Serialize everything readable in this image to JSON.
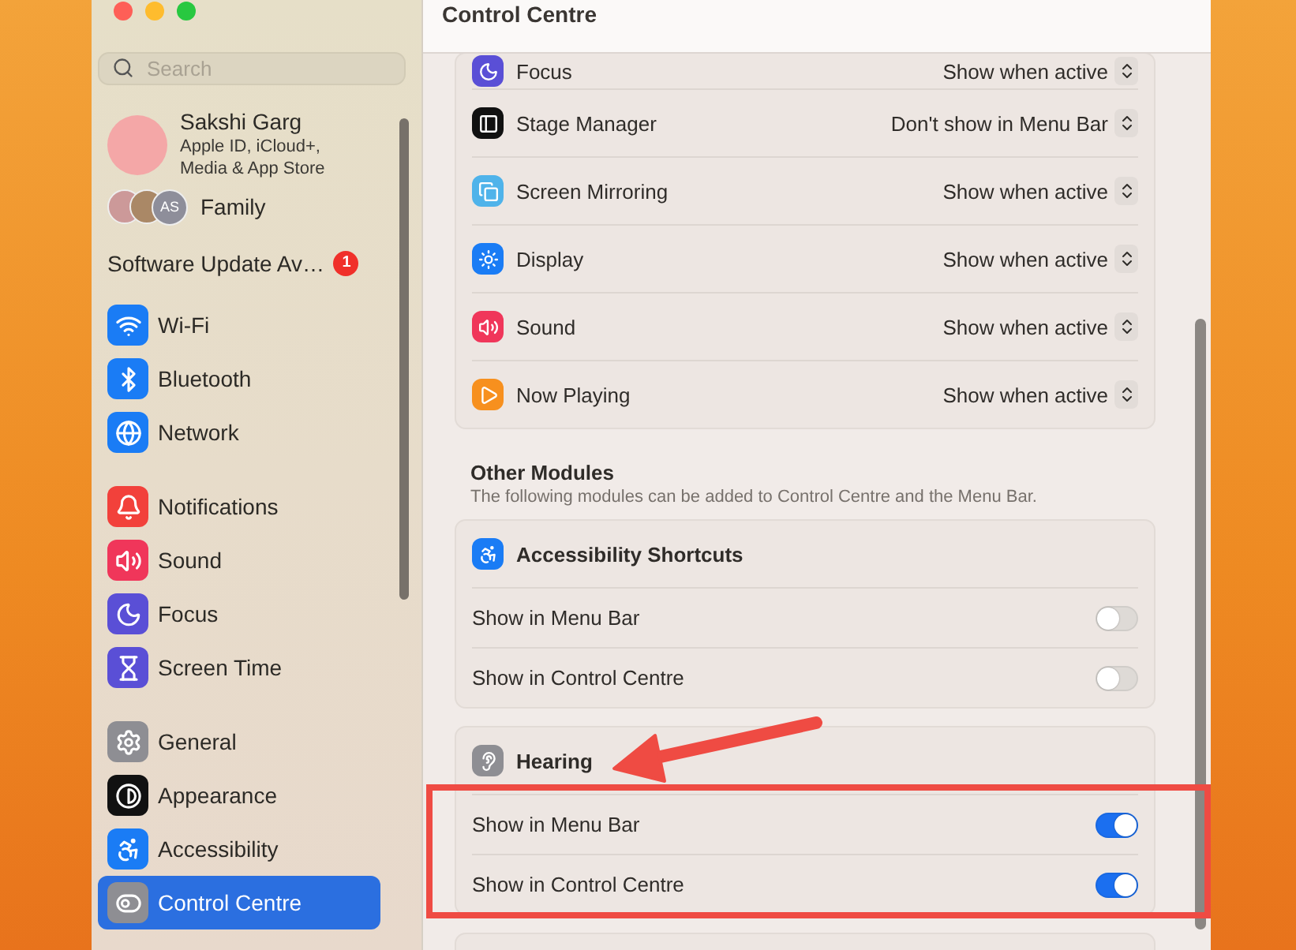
{
  "sidebar": {
    "search": {
      "placeholder": "Search"
    },
    "account": {
      "name": "Sakshi Garg",
      "detail": "Apple ID, iCloud+, Media & App Store"
    },
    "family": {
      "label": "Family",
      "initials": "AS"
    },
    "update": {
      "label": "Software Update Av…",
      "badge": "1"
    },
    "groups": [
      [
        {
          "kind": "wifi",
          "label": "Wi-Fi",
          "selected": false
        },
        {
          "kind": "bluetooth",
          "label": "Bluetooth",
          "selected": false
        },
        {
          "kind": "network",
          "label": "Network",
          "selected": false
        }
      ],
      [
        {
          "kind": "notifications",
          "label": "Notifications",
          "selected": false
        },
        {
          "kind": "sound",
          "label": "Sound",
          "selected": false
        },
        {
          "kind": "focus",
          "label": "Focus",
          "selected": false
        },
        {
          "kind": "screentime",
          "label": "Screen Time",
          "selected": false
        }
      ],
      [
        {
          "kind": "general",
          "label": "General",
          "selected": false
        },
        {
          "kind": "appearance",
          "label": "Appearance",
          "selected": false
        },
        {
          "kind": "accessibility",
          "label": "Accessibility",
          "selected": false
        },
        {
          "kind": "controlcentre",
          "label": "Control Centre",
          "selected": true
        }
      ]
    ]
  },
  "content": {
    "title": "Control Centre",
    "modules": [
      {
        "kind": "focus",
        "label": "Focus",
        "value": "Show when active"
      },
      {
        "kind": "stage",
        "label": "Stage Manager",
        "value": "Don't show in Menu Bar"
      },
      {
        "kind": "mirroring",
        "label": "Screen Mirroring",
        "value": "Show when active"
      },
      {
        "kind": "display",
        "label": "Display",
        "value": "Show when active"
      },
      {
        "kind": "sound",
        "label": "Sound",
        "value": "Show when active"
      },
      {
        "kind": "nowplaying",
        "label": "Now Playing",
        "value": "Show when active"
      }
    ],
    "other": {
      "title": "Other Modules",
      "subtitle": "The following modules can be added to Control Centre and the Menu Bar.",
      "groups": [
        {
          "kind": "accessibility",
          "label": "Accessibility Shortcuts",
          "rows": [
            {
              "label": "Show in Menu Bar",
              "on": false
            },
            {
              "label": "Show in Control Centre",
              "on": false
            }
          ]
        },
        {
          "kind": "hearing",
          "label": "Hearing",
          "rows": [
            {
              "label": "Show in Menu Bar",
              "on": true
            },
            {
              "label": "Show in Control Centre",
              "on": true
            }
          ]
        }
      ]
    }
  }
}
